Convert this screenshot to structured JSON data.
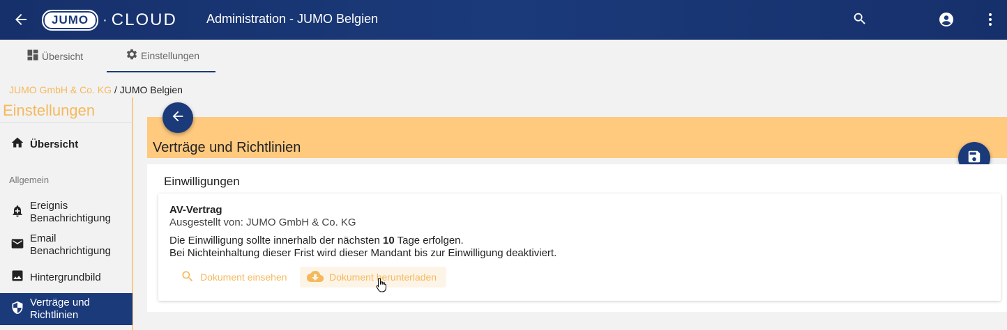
{
  "header": {
    "title": "Administration - JUMO Belgien",
    "logo_brand": "JUMO",
    "logo_cloud": "CLOUD"
  },
  "tabs": [
    {
      "label": "Übersicht",
      "icon": "dashboard-icon",
      "active": false
    },
    {
      "label": "Einstellungen",
      "icon": "gear-icon",
      "active": true
    }
  ],
  "breadcrumb": {
    "parent": "JUMO GmbH & Co. KG",
    "separator": " / ",
    "current": "JUMO Belgien"
  },
  "sidebar": {
    "title": "Einstellungen",
    "overview": "Übersicht",
    "section": "Allgemein",
    "items": [
      {
        "label": "Ereignis Benachrichtigung",
        "icon": "bell-plus-icon"
      },
      {
        "label": "Email Benachrichtigung",
        "icon": "mail-icon"
      },
      {
        "label": "Hintergrundbild",
        "icon": "image-icon"
      },
      {
        "label": "Verträge und Richtlinien",
        "icon": "shield-icon",
        "active": true
      }
    ]
  },
  "main": {
    "page_title": "Verträge und Richtlinien",
    "card_title": "Einwilligungen",
    "contract": {
      "name": "AV-Vertrag",
      "issuer": "Ausgestellt von: JUMO GmbH & Co. KG",
      "line1_prefix": "Die Einwilligung sollte innerhalb der nächsten ",
      "days": "10",
      "line1_suffix": " Tage erfolgen.",
      "line2": "Bei Nichteinhaltung dieser Frist wird dieser Mandant bis zur Einwilligung deaktiviert.",
      "view_button": "Dokument einsehen",
      "download_button": "Dokument herunterladen"
    }
  },
  "colors": {
    "primary": "#1b3a7a",
    "accent": "#f5b95c",
    "banner": "#ffc97e"
  }
}
